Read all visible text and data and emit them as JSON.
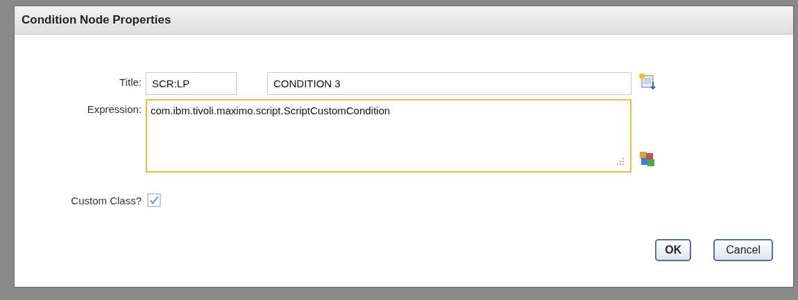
{
  "dialog": {
    "title": "Condition Node Properties"
  },
  "title_field": {
    "label": "Title:",
    "code": "SCR:LP",
    "description": "CONDITION 3"
  },
  "expression": {
    "label": "Expression:",
    "value": "com.ibm.tivoli.maximo.script.ScriptCustomCondition",
    "focused": true
  },
  "custom_class": {
    "label": "Custom Class?",
    "checked": true
  },
  "buttons": [
    {
      "label": "OK",
      "default": true
    },
    {
      "label": "Cancel",
      "default": false
    }
  ]
}
